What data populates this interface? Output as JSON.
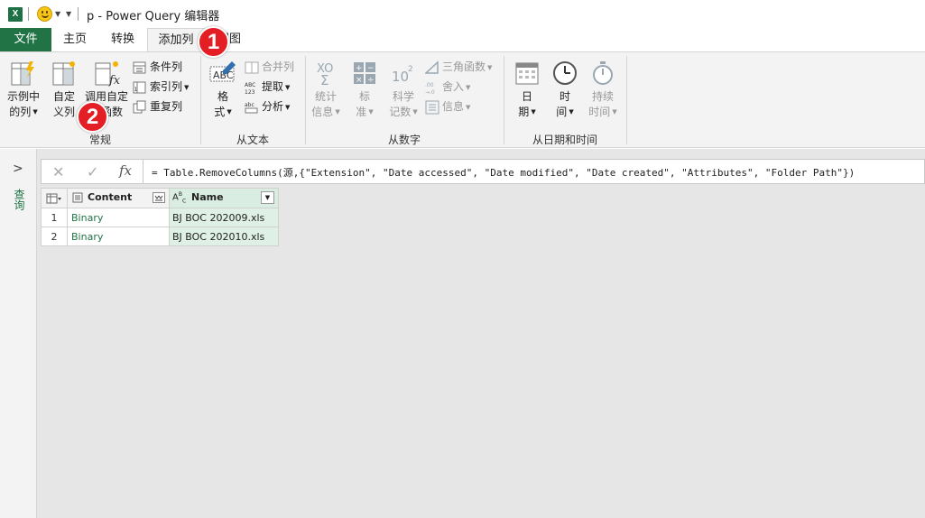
{
  "titlebar": {
    "app_icon": "excel-icon",
    "title": "p - Power Query 编辑器"
  },
  "tabs": [
    {
      "label": "文件"
    },
    {
      "label": "主页"
    },
    {
      "label": "转换"
    },
    {
      "label": "添加列"
    },
    {
      "label": "视图"
    }
  ],
  "ribbon": {
    "groups": {
      "general": {
        "label": "常规",
        "example_col": "示例中\n的列",
        "custom_col": "自定\n义列",
        "invoke_fn": "调用自定\n义函数",
        "cond_col": "条件列",
        "index_col": "索引列",
        "dup_col": "重复列"
      },
      "from_text": {
        "label": "从文本",
        "format": "格\n式",
        "merge": "合并列",
        "extract": "提取",
        "parse": "分析"
      },
      "from_number": {
        "label": "从数字",
        "stats": "统计\n信息",
        "standard": "标\n准",
        "scientific": "科学\n记数",
        "trig": "三角函数",
        "rounding": "舍入",
        "info": "信息"
      },
      "from_datetime": {
        "label": "从日期和时间",
        "date": "日\n期",
        "time": "时\n间",
        "duration": "持续\n时间"
      }
    }
  },
  "leftpane": {
    "label": "查询"
  },
  "formula": {
    "text": "= Table.RemoveColumns(源,{\"Extension\", \"Date accessed\", \"Date modified\", \"Date created\", \"Attributes\", \"Folder Path\"})"
  },
  "table": {
    "columns": [
      {
        "name": "Content"
      },
      {
        "name": "Name"
      }
    ],
    "rows": [
      {
        "index": "1",
        "content": "Binary",
        "name": "BJ BOC 202009.xls"
      },
      {
        "index": "2",
        "content": "Binary",
        "name": "BJ BOC 202010.xls"
      }
    ]
  },
  "callouts": [
    "1",
    "2"
  ],
  "colors": {
    "accent": "#217346",
    "callout": "#e31e24"
  }
}
